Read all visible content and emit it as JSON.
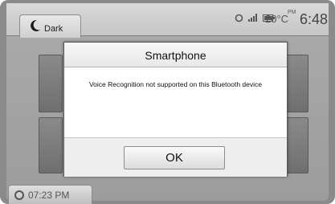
{
  "status_bar": {
    "theme_label": "Dark",
    "temperature": "20°C",
    "meridiem": "PM",
    "time": "6:48"
  },
  "dialog": {
    "title": "Smartphone",
    "message": "Voice Recognition not supported on this Bluetooth device",
    "ok_label": "OK"
  },
  "footer": {
    "call_time": "07:23 PM"
  },
  "icons": {
    "theme": "moon-icon",
    "status": [
      "phone-link-icon",
      "signal-bars-icon",
      "battery-icon"
    ],
    "footer": "phone-link-icon"
  }
}
